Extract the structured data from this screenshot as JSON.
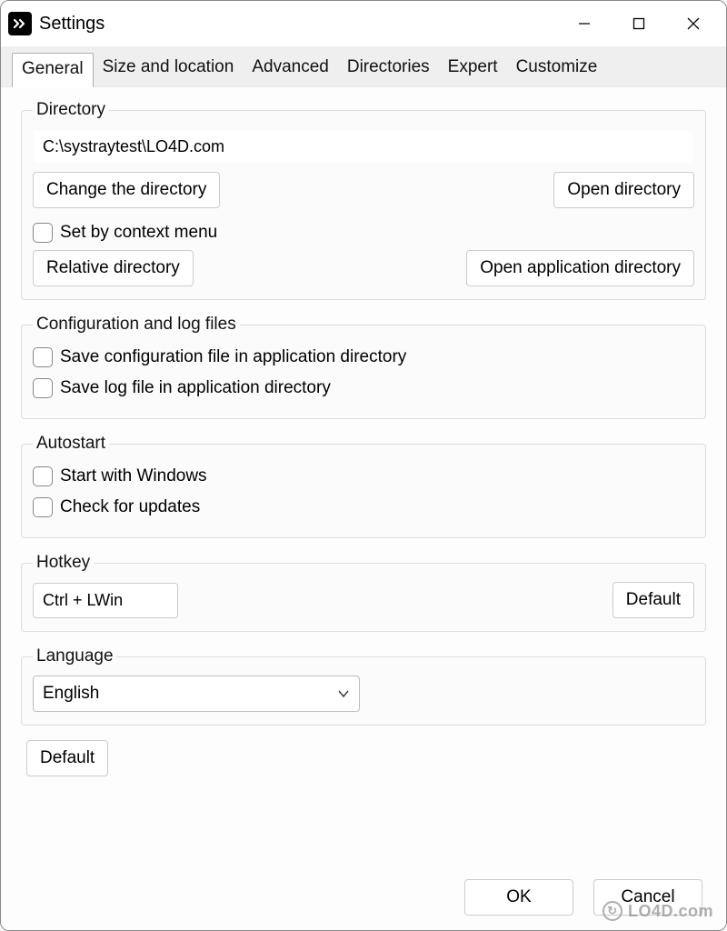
{
  "window": {
    "title": "Settings"
  },
  "tabs": [
    {
      "label": "General",
      "active": true
    },
    {
      "label": "Size and location"
    },
    {
      "label": "Advanced"
    },
    {
      "label": "Directories"
    },
    {
      "label": "Expert"
    },
    {
      "label": "Customize"
    }
  ],
  "directory": {
    "legend": "Directory",
    "path": "C:\\systraytest\\LO4D.com",
    "change_btn": "Change the directory",
    "open_btn": "Open directory",
    "set_by_context": "Set by context menu",
    "relative_btn": "Relative directory",
    "open_app_dir_btn": "Open application directory"
  },
  "config": {
    "legend": "Configuration and log files",
    "save_config": "Save configuration file in application directory",
    "save_log": "Save log file in application directory"
  },
  "autostart": {
    "legend": "Autostart",
    "start_with_windows": "Start with Windows",
    "check_updates": "Check for updates"
  },
  "hotkey": {
    "legend": "Hotkey",
    "value": "Ctrl + LWin",
    "default_btn": "Default"
  },
  "language": {
    "legend": "Language",
    "value": "English"
  },
  "bottom": {
    "default_btn": "Default",
    "ok_btn": "OK",
    "cancel_btn": "Cancel"
  },
  "watermark": "LO4D.com"
}
